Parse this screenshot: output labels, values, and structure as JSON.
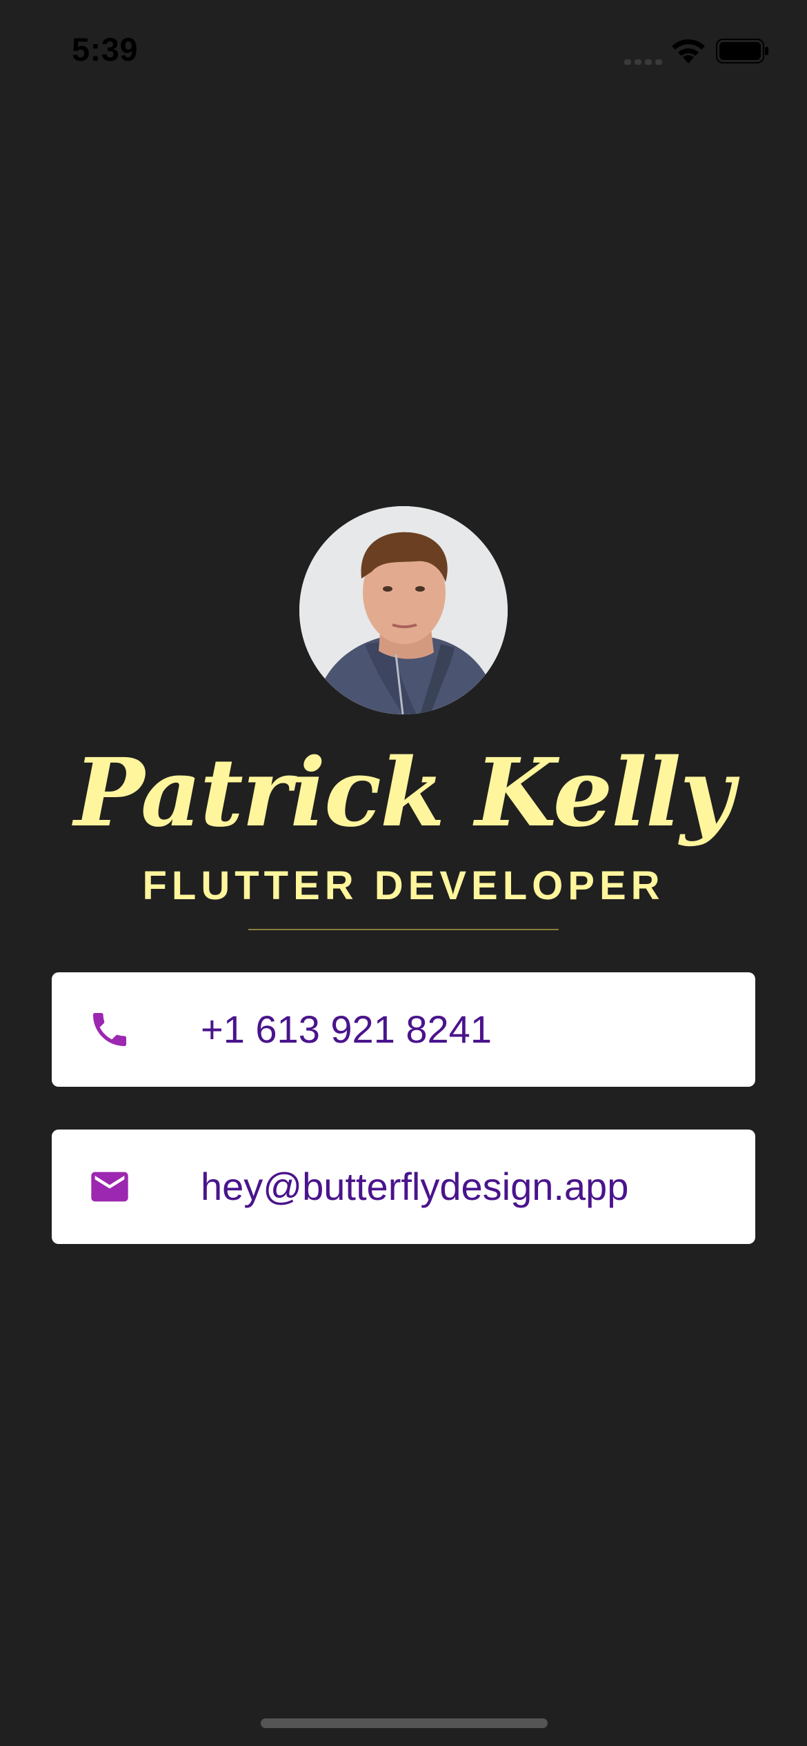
{
  "status_bar": {
    "time": "5:39",
    "icons": [
      "signal-icon",
      "wifi-icon",
      "battery-icon"
    ]
  },
  "profile": {
    "name": "Patrick Kelly",
    "title": "FLUTTER DEVELOPER"
  },
  "contacts": {
    "phone": {
      "icon": "phone-icon",
      "value": "+1 613 921 8241"
    },
    "email": {
      "icon": "email-icon",
      "value": "hey@butterflydesign.app"
    }
  },
  "colors": {
    "background": "#202020",
    "accent_yellow": "#fff59d",
    "icon_purple": "#9c27b0",
    "text_purple": "#4a148c",
    "card": "#ffffff"
  }
}
